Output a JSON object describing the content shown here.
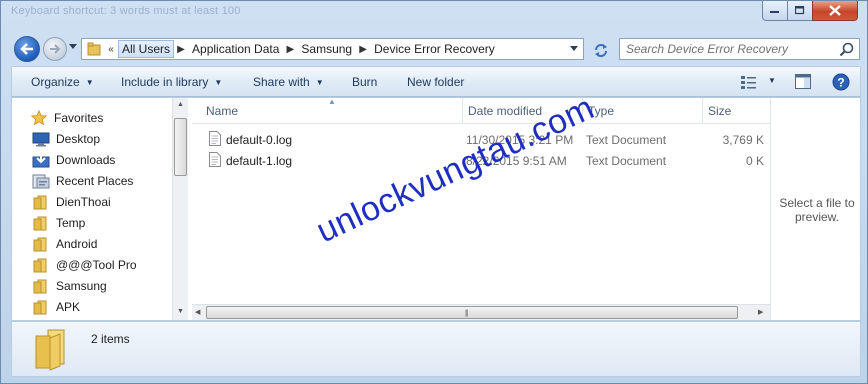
{
  "window": {
    "title": "Device Error Recovery",
    "faded_title": "Keyboard shortcut: 3 words must at least 100",
    "controls": [
      "minimize",
      "maximize",
      "close"
    ]
  },
  "nav": {
    "overflow_chevron": "«",
    "breadcrumbs": [
      "All Users",
      "Application Data",
      "Samsung",
      "Device Error Recovery"
    ],
    "search_placeholder": "Search Device Error Recovery"
  },
  "toolbar": {
    "organize": "Organize",
    "include_in_library": "Include in library",
    "share_with": "Share with",
    "burn": "Burn",
    "new_folder": "New folder"
  },
  "sidebar": {
    "favorites_label": "Favorites",
    "items": [
      {
        "label": "Desktop",
        "icon": "desktop-icon"
      },
      {
        "label": "Downloads",
        "icon": "downloads-icon"
      },
      {
        "label": "Recent Places",
        "icon": "recent-places-icon"
      },
      {
        "label": "DienThoai",
        "icon": "folder-icon"
      },
      {
        "label": "Temp",
        "icon": "folder-icon"
      },
      {
        "label": "Android",
        "icon": "folder-icon"
      },
      {
        "label": "@@@Tool Pro",
        "icon": "folder-icon"
      },
      {
        "label": "Samsung",
        "icon": "folder-icon"
      },
      {
        "label": "APK",
        "icon": "folder-icon"
      }
    ]
  },
  "files": {
    "columns": [
      "Name",
      "Date modified",
      "Type",
      "Size"
    ],
    "rows": [
      {
        "name": "default-0.log",
        "date": "11/30/2015 3:21 PM",
        "type": "Text Document",
        "size": "3,769 K"
      },
      {
        "name": "default-1.log",
        "date": "8/22/2015 9:51 AM",
        "type": "Text Document",
        "size": "0 K"
      }
    ]
  },
  "preview": {
    "message": "Select a file to preview."
  },
  "details": {
    "count": "2 items"
  },
  "watermark": {
    "text": "unlockvungtau.com"
  },
  "colors": {
    "frame": "#c9dcef",
    "command_text": "#1e395b",
    "watermark": "#1f2ec2",
    "close_button": "#c6452a"
  }
}
